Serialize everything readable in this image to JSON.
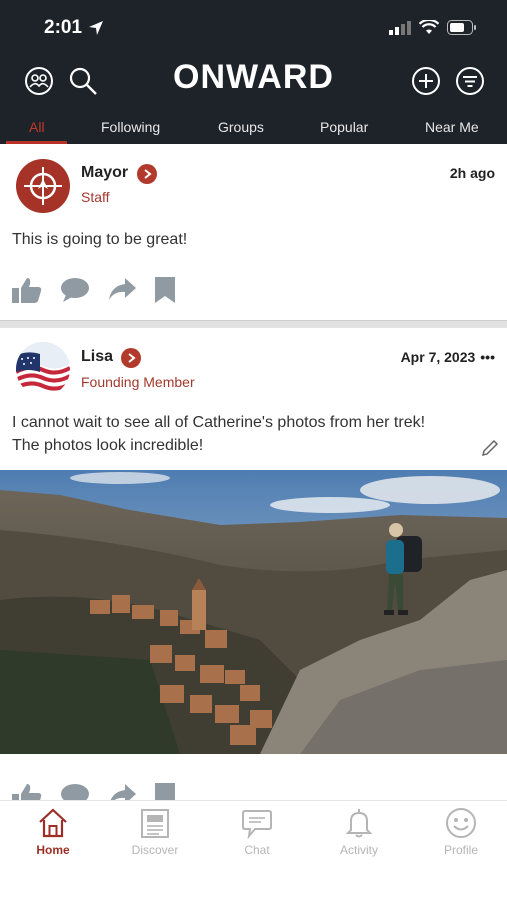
{
  "status_bar": {
    "time": "2:01"
  },
  "header": {
    "logo_text": "ONWARD"
  },
  "tabs": [
    {
      "label": "All",
      "active": true
    },
    {
      "label": "Following"
    },
    {
      "label": "Groups"
    },
    {
      "label": "Popular"
    },
    {
      "label": "Near Me"
    }
  ],
  "posts": [
    {
      "author": "Mayor",
      "role": "Staff",
      "time": "2h ago",
      "text": "This is going to be great!"
    },
    {
      "author": "Lisa",
      "role": "Founding Member",
      "time": "Apr 7, 2023",
      "more": "•••",
      "text_line1": "I cannot wait to see all of Catherine's photos from her trek!",
      "text_line2": "The photos look incredible!"
    }
  ],
  "bottom_nav": [
    {
      "label": "Home",
      "icon": "home-icon",
      "active": true
    },
    {
      "label": "Discover",
      "icon": "newspaper-icon"
    },
    {
      "label": "Chat",
      "icon": "chat-bubble-icon"
    },
    {
      "label": "Activity",
      "icon": "bell-icon"
    },
    {
      "label": "Profile",
      "icon": "smiley-icon"
    }
  ],
  "colors": {
    "header_bg": "#1e2229",
    "accent": "#b23a2c",
    "action_icon": "#8f9aa3"
  }
}
